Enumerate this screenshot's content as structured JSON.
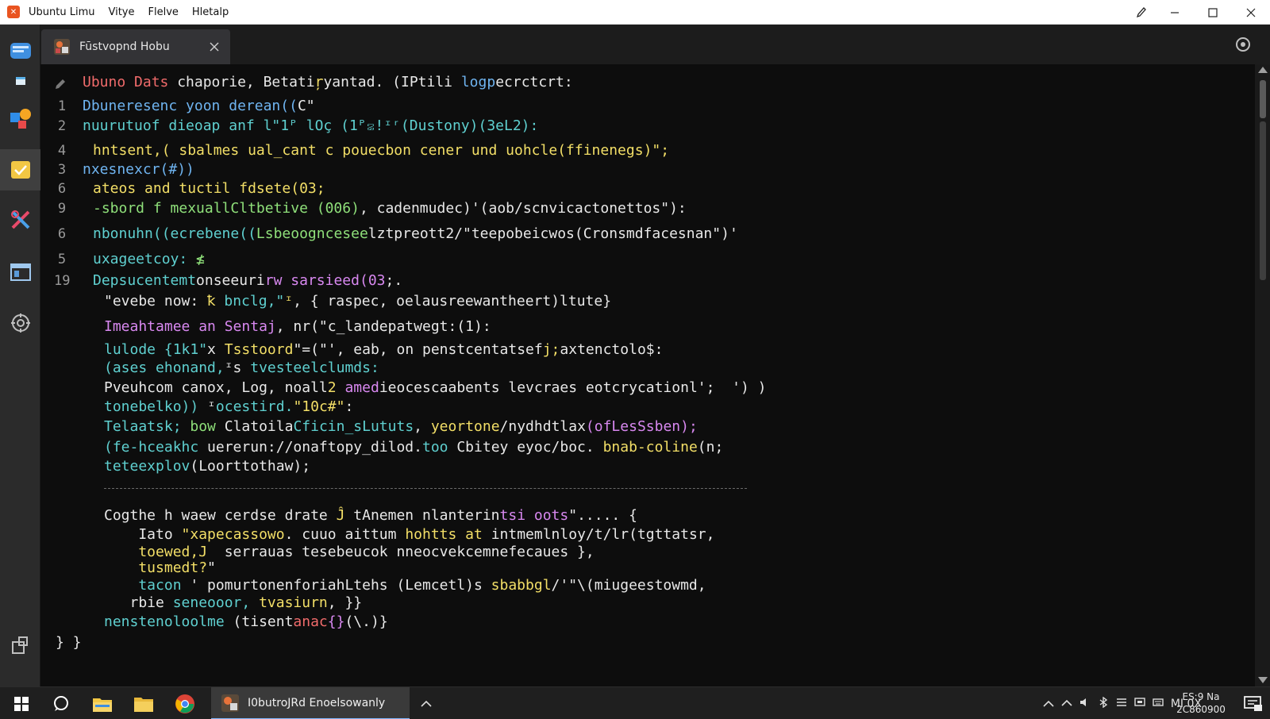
{
  "titlebar": {
    "menu": [
      "Ubuntu Limu",
      "Vitye",
      "Flelve",
      "Hletalp"
    ]
  },
  "tab": {
    "label": "Fūstvopnd Hobu"
  },
  "editor": {
    "lines": [
      {
        "num": "",
        "segments": [
          {
            "c": "c-r",
            "t": "Ubuno Dats"
          },
          {
            "c": "c-w",
            "t": " chaporie, Betati"
          },
          {
            "c": "c-y",
            "t": "ŗ"
          },
          {
            "c": "c-w",
            "t": "yantad. (IPtili "
          },
          {
            "c": "c-b",
            "t": "logp"
          },
          {
            "c": "c-w",
            "t": "ecrctcrt:"
          }
        ]
      },
      {
        "num": "1",
        "segments": [
          {
            "c": "c-b",
            "t": "Dbuneresenc yoon derean(("
          },
          {
            "c": "c-w",
            "t": "C\""
          }
        ]
      },
      {
        "num": "2",
        "segments": [
          {
            "c": "c-c",
            "t": "nuurutuof dieoap anf l\"1ᴾ lOç (1ᴾ꤃!ᶦʳ("
          },
          {
            "c": "c-c",
            "t": "Dustony)(3eL2):"
          }
        ]
      },
      {
        "num": "4",
        "segments": [
          {
            "c": "c-y",
            "t": "hntsent,( sbalmes ual_cant c pouecbon cener und uohcle(ffinenegs)\";"
          }
        ]
      },
      {
        "num": "3",
        "segments": [
          {
            "c": "c-b",
            "t": "nxesnexcr(#))"
          }
        ]
      },
      {
        "num": "6",
        "segments": [
          {
            "c": "c-y",
            "t": "ateos and tuctil fdsete(03;"
          }
        ]
      },
      {
        "num": "9",
        "segments": [
          {
            "c": "c-g",
            "t": "-sbord f mexuallCltbetive (006)"
          },
          {
            "c": "c-w",
            "t": ", cadenmudec)'(aob/scnvicactonettos\"):"
          }
        ]
      },
      {
        "num": "6",
        "segments": [
          {
            "c": "c-c",
            "t": "nbonuhn((ecrebene(("
          },
          {
            "c": "c-g",
            "t": "Lsbeoogncesee"
          },
          {
            "c": "c-w",
            "t": "lztpreott2/\"teepobeicwos(Cronsmdfacesnan\")'"
          }
        ]
      },
      {
        "num": "5",
        "segments": [
          {
            "c": "c-c",
            "t": "uxageetcoy: "
          },
          {
            "c": "c-g",
            "t": "≰"
          }
        ]
      },
      {
        "num": "19",
        "segments": [
          {
            "c": "c-c",
            "t": "Depsucentemt"
          },
          {
            "c": "c-w",
            "t": "onseeuri"
          },
          {
            "c": "c-p",
            "t": "rw"
          },
          {
            "c": "c-w",
            "t": " "
          },
          {
            "c": "c-p",
            "t": "sarsieed(03"
          },
          {
            "c": "c-w",
            "t": ";."
          }
        ]
      },
      {
        "num": "",
        "segments": [
          {
            "c": "c-w",
            "t": "\"evebe now: "
          },
          {
            "c": "c-y",
            "t": "ꝁ"
          },
          {
            "c": "c-c",
            "t": " bnclg,\""
          },
          {
            "c": "c-y",
            "t": "ᶦ"
          },
          {
            "c": "c-w",
            "t": ", { raspec, oelausreewantheert)ltute}"
          }
        ]
      },
      {
        "num": "",
        "segments": [
          {
            "c": "c-p",
            "t": "Imeahtamee an Sentaj"
          },
          {
            "c": "c-w",
            "t": ", nr(\"c_landepatwegt:(1):"
          }
        ]
      },
      {
        "num": "",
        "segments": [
          {
            "c": "c-c",
            "t": "lulode {1k1\""
          },
          {
            "c": "c-w",
            "t": "x "
          },
          {
            "c": "c-y",
            "t": "Tsstoord"
          },
          {
            "c": "c-w",
            "t": "\"=(\"', eab, on penstcentatsef"
          },
          {
            "c": "c-y",
            "t": "j;"
          },
          {
            "c": "c-w",
            "t": "axtenctolo$:"
          }
        ]
      },
      {
        "num": "",
        "segments": [
          {
            "c": "c-c",
            "t": "(ases ehonand,"
          },
          {
            "c": "c-w",
            "t": "ᶦs "
          },
          {
            "c": "c-c",
            "t": "tvesteelclumds:"
          }
        ]
      },
      {
        "num": "",
        "segments": [
          {
            "c": "c-w",
            "t": "Pveuhcom canox, Log, noall"
          },
          {
            "c": "c-y",
            "t": "2"
          },
          {
            "c": "c-w",
            "t": " "
          },
          {
            "c": "c-p",
            "t": "amed"
          },
          {
            "c": "c-w",
            "t": "ieocescaabents levcraes eotcrycationl';  ') )"
          }
        ]
      },
      {
        "num": "",
        "segments": [
          {
            "c": "c-c",
            "t": "tonebelko)) "
          },
          {
            "c": "c-w",
            "t": "ᶦ"
          },
          {
            "c": "c-c",
            "t": "ocestird."
          },
          {
            "c": "c-y",
            "t": "\"10c#\""
          },
          {
            "c": "c-w",
            "t": ":"
          }
        ]
      },
      {
        "num": "",
        "segments": [
          {
            "c": "c-c",
            "t": "Telaatsk; "
          },
          {
            "c": "c-g",
            "t": "bow "
          },
          {
            "c": "c-w",
            "t": "Clatoila"
          },
          {
            "c": "c-c",
            "t": "Cficin_sLututs"
          },
          {
            "c": "c-w",
            "t": ", "
          },
          {
            "c": "c-y",
            "t": "yeortone"
          },
          {
            "c": "c-w",
            "t": "/nydhdtlax"
          },
          {
            "c": "c-p",
            "t": "(ofLesSsben);"
          }
        ]
      },
      {
        "num": "",
        "segments": [
          {
            "c": "c-c",
            "t": "(fe-hceakhc "
          },
          {
            "c": "c-w",
            "t": "uererun://onaftopy_dilod."
          },
          {
            "c": "c-c",
            "t": "too "
          },
          {
            "c": "c-w",
            "t": "Cbitey eyoc/boc. "
          },
          {
            "c": "c-y",
            "t": "bnab-coline"
          },
          {
            "c": "c-w",
            "t": "(n;"
          }
        ]
      },
      {
        "num": "",
        "segments": [
          {
            "c": "c-c",
            "t": "teteexplov"
          },
          {
            "c": "c-w",
            "t": "(Loorttothaw);"
          }
        ]
      },
      {
        "num": "",
        "segments": [
          {
            "c": "c-w",
            "t": "Cogthe h waew cerdse drate "
          },
          {
            "c": "c-y",
            "t": "Ĵ"
          },
          {
            "c": "c-w",
            "t": " tAnemen nlanterin"
          },
          {
            "c": "c-p",
            "t": "tsi oots"
          },
          {
            "c": "c-w",
            "t": "\"..... {"
          }
        ]
      },
      {
        "num": "",
        "segments": [
          {
            "c": "c-w",
            "t": "    Iato "
          },
          {
            "c": "c-y",
            "t": "\"xapecassowo"
          },
          {
            "c": "c-w",
            "t": ". cuuo aittum "
          },
          {
            "c": "c-y",
            "t": "hohtts at"
          },
          {
            "c": "c-w",
            "t": " intmemlnloy/t/lr(tgttatsr,"
          }
        ]
      },
      {
        "num": "",
        "segments": [
          {
            "c": "c-y",
            "t": "    toewed,J"
          },
          {
            "c": "c-w",
            "t": "  serrauas tesebeucok nneocvekcemnefecaues },"
          }
        ]
      },
      {
        "num": "",
        "segments": [
          {
            "c": "c-y",
            "t": "    tusmedt?"
          },
          {
            "c": "c-w",
            "t": "\""
          }
        ]
      },
      {
        "num": "",
        "segments": [
          {
            "c": "c-c",
            "t": "    tacon "
          },
          {
            "c": "c-w",
            "t": "' pomurtonenforiahLtehs (Lemcetl)s "
          },
          {
            "c": "c-y",
            "t": "sbabbgl"
          },
          {
            "c": "c-w",
            "t": "/'\"\\(miugeestowmd,"
          }
        ]
      },
      {
        "num": "",
        "segments": [
          {
            "c": "c-w",
            "t": "   rbie "
          },
          {
            "c": "c-c",
            "t": "seneooor, "
          },
          {
            "c": "c-y",
            "t": "tvasiurn"
          },
          {
            "c": "c-w",
            "t": ", }}"
          }
        ]
      },
      {
        "num": "",
        "segments": [
          {
            "c": "c-c",
            "t": "nenstenoloolme"
          },
          {
            "c": "c-w",
            "t": " (tisent"
          },
          {
            "c": "c-r",
            "t": "anac"
          },
          {
            "c": "c-p",
            "t": "{}"
          },
          {
            "c": "c-w",
            "t": "(\\.)}"
          }
        ]
      },
      {
        "num": "",
        "segments": [
          {
            "c": "c-w",
            "t": "} }"
          }
        ]
      }
    ]
  },
  "taskbar": {
    "app_label": "I0butroJRd Enoelsowanly",
    "tray_text": "MI 0X",
    "clock_time": "ES:9 Na",
    "clock_date": "2C860900"
  },
  "colors": {
    "accent": "#7fb6ff",
    "ubuntu_orange": "#e95420",
    "editor_bg": "#0d0d0d"
  }
}
